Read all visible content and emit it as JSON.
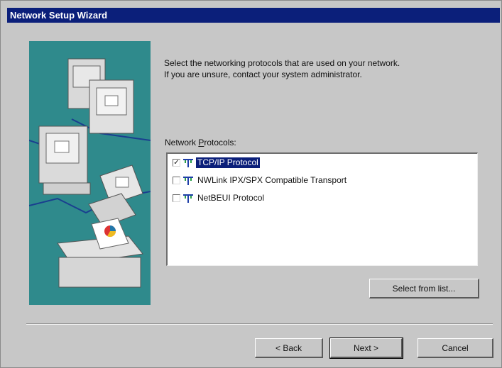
{
  "window": {
    "title": "Network Setup Wizard"
  },
  "instructions": {
    "line1": "Select the networking protocols that are used on your network.",
    "line2": "If you are unsure, contact your system administrator."
  },
  "protocols_label": {
    "prefix": "Network ",
    "accel": "P",
    "suffix": "rotocols:"
  },
  "protocols": [
    {
      "label": "TCP/IP Protocol",
      "checked": true,
      "selected": true
    },
    {
      "label": "NWLink IPX/SPX Compatible Transport",
      "checked": false,
      "selected": false
    },
    {
      "label": "NetBEUI Protocol",
      "checked": false,
      "selected": false
    }
  ],
  "buttons": {
    "select_from_list": "Select from list...",
    "back": "< Back",
    "next": "Next >",
    "cancel": "Cancel"
  },
  "colors": {
    "title_bar": "#0b1f7a",
    "illustration_bg": "#2f8a8c",
    "selection": "#0b1f7a"
  },
  "icons": {
    "protocol": "network-protocol-icon",
    "illustration": "networked-computers-illustration"
  }
}
